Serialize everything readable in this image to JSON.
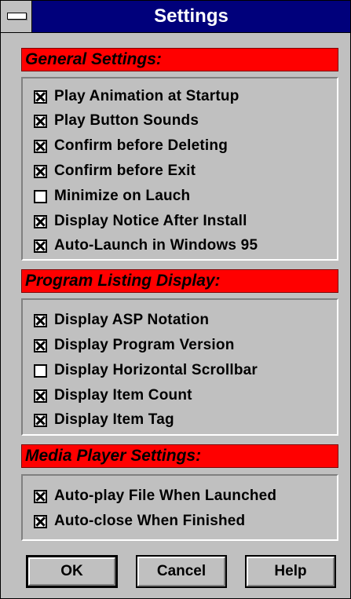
{
  "window": {
    "title": "Settings"
  },
  "sections": [
    {
      "title": "General Settings:",
      "items": [
        {
          "label": "Play Animation at Startup",
          "checked": true
        },
        {
          "label": "Play Button Sounds",
          "checked": true
        },
        {
          "label": "Confirm before Deleting",
          "checked": true
        },
        {
          "label": "Confirm before Exit",
          "checked": true
        },
        {
          "label": "Minimize on Lauch",
          "checked": false
        },
        {
          "label": "Display Notice After Install",
          "checked": true
        },
        {
          "label": "Auto-Launch in Windows 95",
          "checked": true
        }
      ]
    },
    {
      "title": "Program Listing Display:",
      "items": [
        {
          "label": "Display ASP Notation",
          "checked": true
        },
        {
          "label": "Display Program Version",
          "checked": true
        },
        {
          "label": "Display Horizontal Scrollbar",
          "checked": false
        },
        {
          "label": "Display Item Count",
          "checked": true
        },
        {
          "label": "Display Item Tag",
          "checked": true
        }
      ]
    },
    {
      "title": "Media Player Settings:",
      "items": [
        {
          "label": "Auto-play File When Launched",
          "checked": true
        },
        {
          "label": "Auto-close When Finished",
          "checked": true
        }
      ]
    }
  ],
  "buttons": {
    "ok": "OK",
    "cancel": "Cancel",
    "help": "Help"
  },
  "colors": {
    "titlebar": "#00007b",
    "section_header": "#ff0000",
    "face": "#c0c0c0"
  }
}
